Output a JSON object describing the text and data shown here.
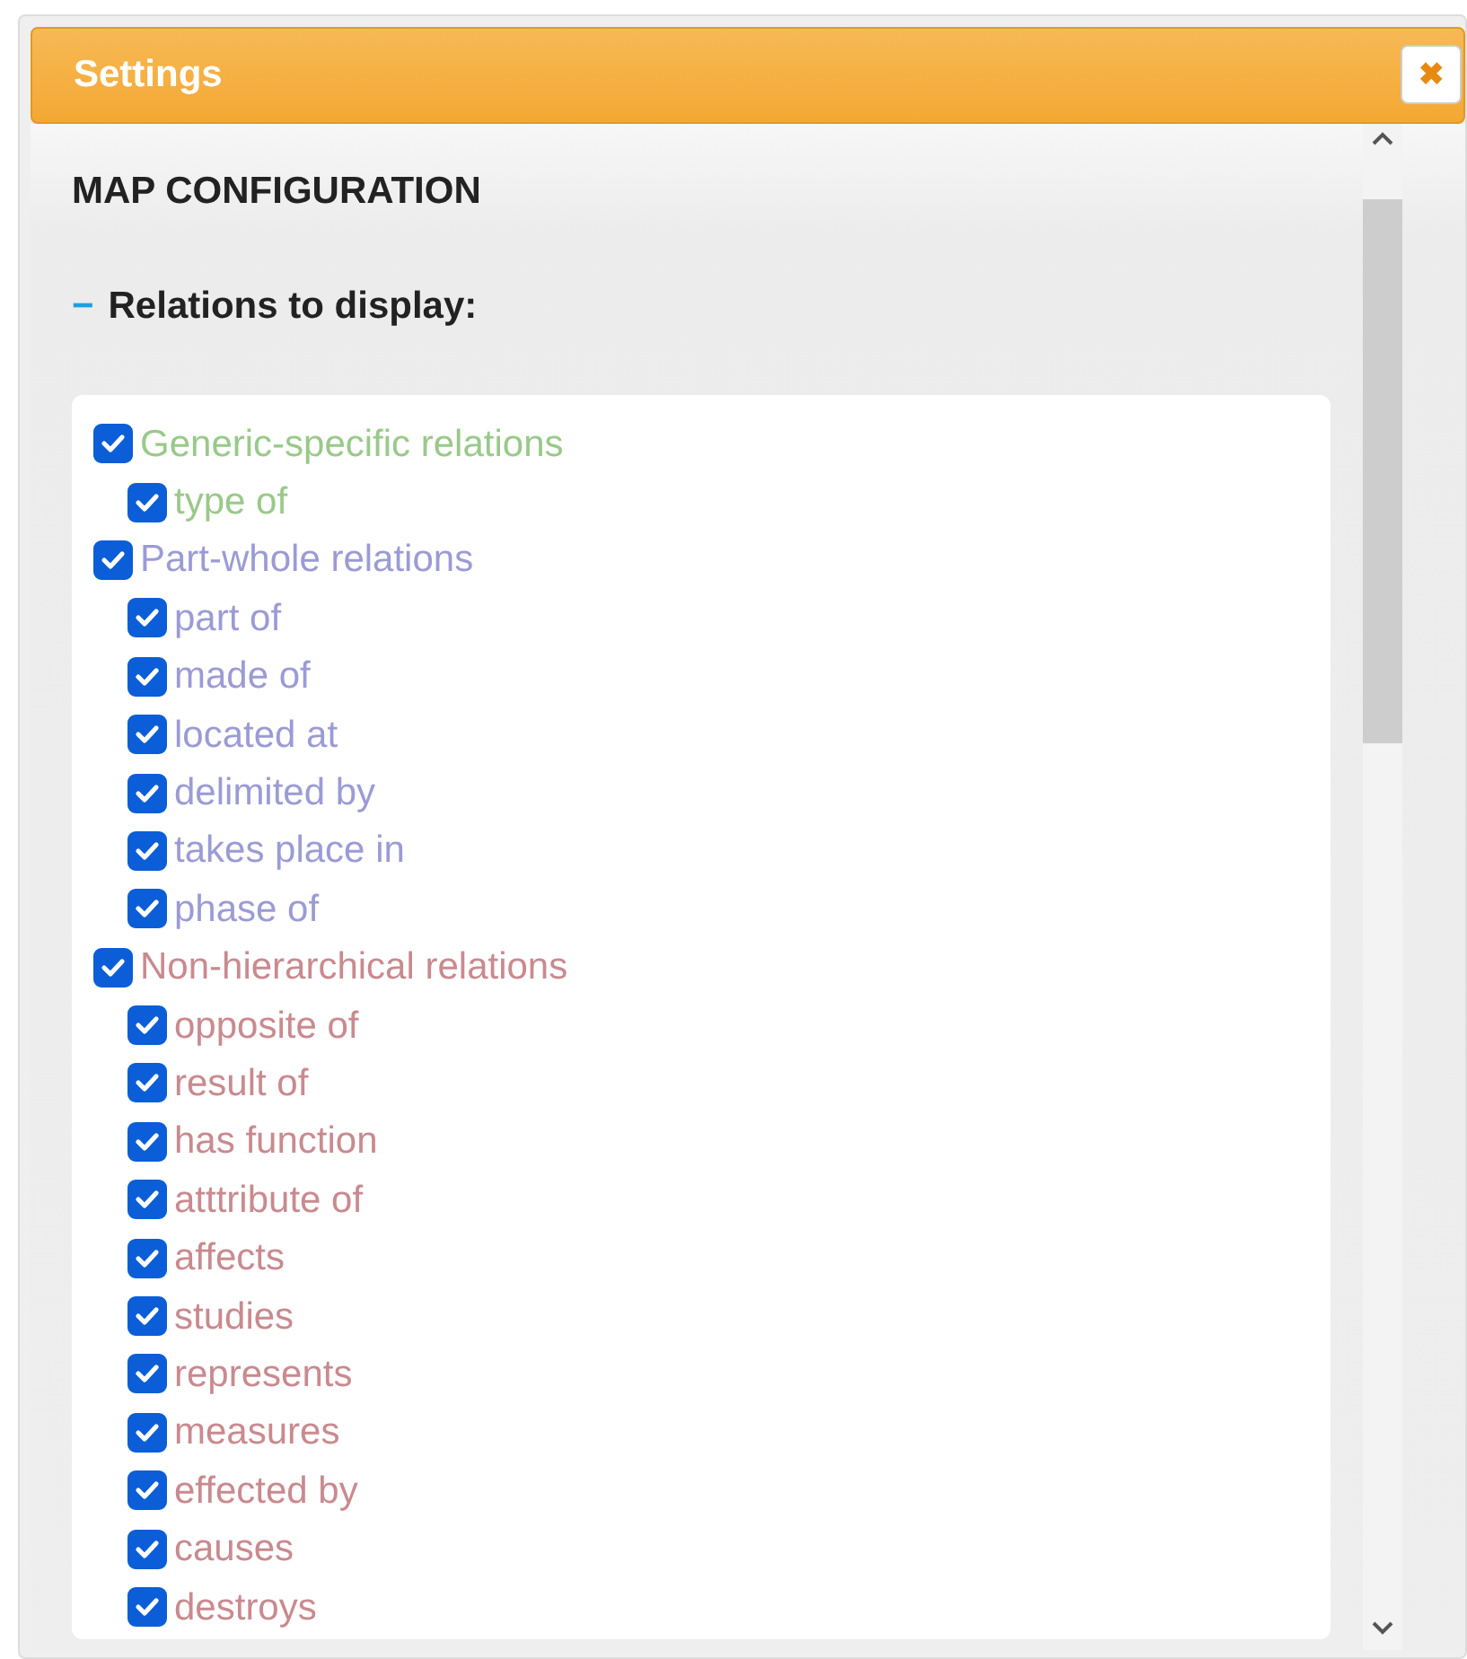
{
  "dialog": {
    "title": "Settings",
    "close_icon": "✖"
  },
  "section_title": "MAP CONFIGURATION",
  "relations": {
    "toggle": "−",
    "label": "Relations to display:"
  },
  "groups": [
    {
      "label": "Generic-specific relations",
      "checked": true,
      "color": "#99c98a",
      "children": [
        {
          "label": "type of",
          "checked": true
        }
      ]
    },
    {
      "label": "Part-whole relations",
      "checked": true,
      "color": "#9b9bd6",
      "children": [
        {
          "label": "part of",
          "checked": true
        },
        {
          "label": "made of",
          "checked": true
        },
        {
          "label": "located at",
          "checked": true
        },
        {
          "label": "delimited by",
          "checked": true
        },
        {
          "label": "takes place in",
          "checked": true
        },
        {
          "label": "phase of",
          "checked": true
        }
      ]
    },
    {
      "label": "Non-hierarchical relations",
      "checked": true,
      "color": "#c98a8f",
      "children": [
        {
          "label": "opposite of",
          "checked": true
        },
        {
          "label": "result of",
          "checked": true
        },
        {
          "label": "has function",
          "checked": true
        },
        {
          "label": "atttribute of",
          "checked": true
        },
        {
          "label": "affects",
          "checked": true
        },
        {
          "label": "studies",
          "checked": true
        },
        {
          "label": "represents",
          "checked": true
        },
        {
          "label": "measures",
          "checked": true
        },
        {
          "label": "effected by",
          "checked": true
        },
        {
          "label": "causes",
          "checked": true
        },
        {
          "label": "destroys",
          "checked": true
        }
      ]
    }
  ]
}
